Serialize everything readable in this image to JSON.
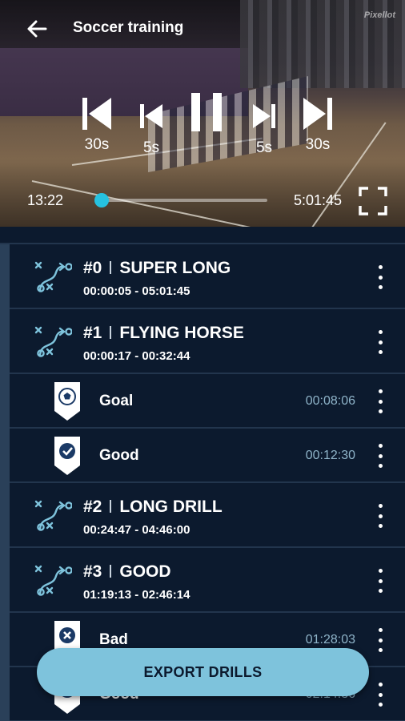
{
  "header": {
    "title": "Soccer training",
    "brand": "Pixellot"
  },
  "player": {
    "rewind_long_label": "30s",
    "rewind_short_label": "5s",
    "forward_short_label": "5s",
    "forward_long_label": "30s",
    "current_time": "13:22",
    "total_time": "5:01:45",
    "progress_fraction": 0.003
  },
  "list": {
    "rows": [
      {
        "kind": "drill",
        "number": "#0",
        "name": "SUPER LONG",
        "range": "00:00:05 - 05:01:45"
      },
      {
        "kind": "drill",
        "number": "#1",
        "name": "FLYING HORSE",
        "range": "00:00:17 - 00:32:44"
      },
      {
        "kind": "tag",
        "icon": "soccer-ball-icon",
        "label": "Goal",
        "time": "00:08:06"
      },
      {
        "kind": "tag",
        "icon": "check-icon",
        "label": "Good",
        "time": "00:12:30"
      },
      {
        "kind": "drill",
        "number": "#2",
        "name": "LONG DRILL",
        "range": "00:24:47 - 04:46:00"
      },
      {
        "kind": "drill",
        "number": "#3",
        "name": "GOOD",
        "range": "01:19:13 - 02:46:14"
      },
      {
        "kind": "tag",
        "icon": "x-icon",
        "label": "Bad",
        "time": "01:28:03"
      },
      {
        "kind": "tag",
        "icon": "check-icon",
        "label": "Good",
        "time": "02:14:36"
      }
    ]
  },
  "export_button": {
    "label": "EXPORT DRILLS"
  },
  "colors": {
    "accent": "#26b7d6",
    "background": "#0c1a2e",
    "button": "#7ec3dc",
    "row_divider": "#22354d"
  }
}
